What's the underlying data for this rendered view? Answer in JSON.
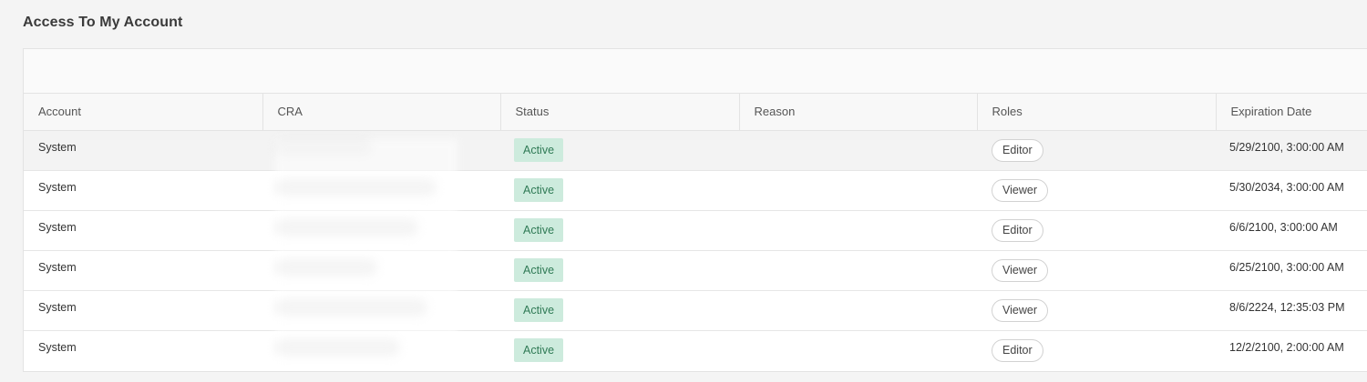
{
  "page": {
    "title": "Access To My Account"
  },
  "table": {
    "columns": [
      "Account",
      "CRA",
      "Status",
      "Reason",
      "Roles",
      "Expiration Date"
    ],
    "rows": [
      {
        "account": "System",
        "cra": "",
        "status": "Active",
        "reason": "",
        "role": "Editor",
        "expiration": "5/29/2100, 3:00:00 AM"
      },
      {
        "account": "System",
        "cra": "",
        "status": "Active",
        "reason": "",
        "role": "Viewer",
        "expiration": "5/30/2034, 3:00:00 AM"
      },
      {
        "account": "System",
        "cra": "",
        "status": "Active",
        "reason": "",
        "role": "Editor",
        "expiration": "6/6/2100, 3:00:00 AM"
      },
      {
        "account": "System",
        "cra": "",
        "status": "Active",
        "reason": "",
        "role": "Viewer",
        "expiration": "6/25/2100, 3:00:00 AM"
      },
      {
        "account": "System",
        "cra": "",
        "status": "Active",
        "reason": "",
        "role": "Viewer",
        "expiration": "8/6/2224, 12:35:03 PM"
      },
      {
        "account": "System",
        "cra": "",
        "status": "Active",
        "reason": "",
        "role": "Editor",
        "expiration": "12/2/2100, 2:00:00 AM"
      }
    ]
  },
  "colors": {
    "status_active_bg": "#cdebdd",
    "status_active_text": "#2f7a55",
    "page_bg": "#f4f4f4"
  }
}
